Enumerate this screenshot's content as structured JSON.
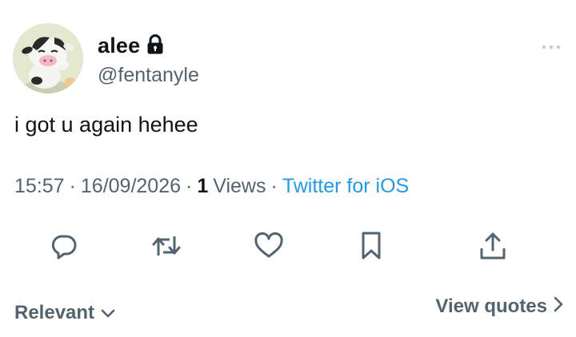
{
  "author": {
    "display_name": "alee",
    "handle": "@fentanyle",
    "avatar": "cow-avatar",
    "protected_icon": "lock-icon"
  },
  "tweet": {
    "text": "i got u again hehee",
    "time": "15:57",
    "date": "16/09/2026",
    "separator": "·",
    "views_count": "1",
    "views_label": "Views",
    "source": "Twitter for iOS"
  },
  "actions": [
    {
      "name": "reply",
      "icon": "reply-icon"
    },
    {
      "name": "retweet",
      "icon": "retweet-icon"
    },
    {
      "name": "like",
      "icon": "heart-icon"
    },
    {
      "name": "bookmark",
      "icon": "bookmark-icon"
    },
    {
      "name": "share",
      "icon": "share-icon"
    }
  ],
  "footer": {
    "sort_label": "Relevant",
    "quotes_label": "View quotes"
  },
  "colors": {
    "text": "#0f1419",
    "secondary": "#536471",
    "link": "#1d9bf0",
    "icon": "#536471"
  }
}
